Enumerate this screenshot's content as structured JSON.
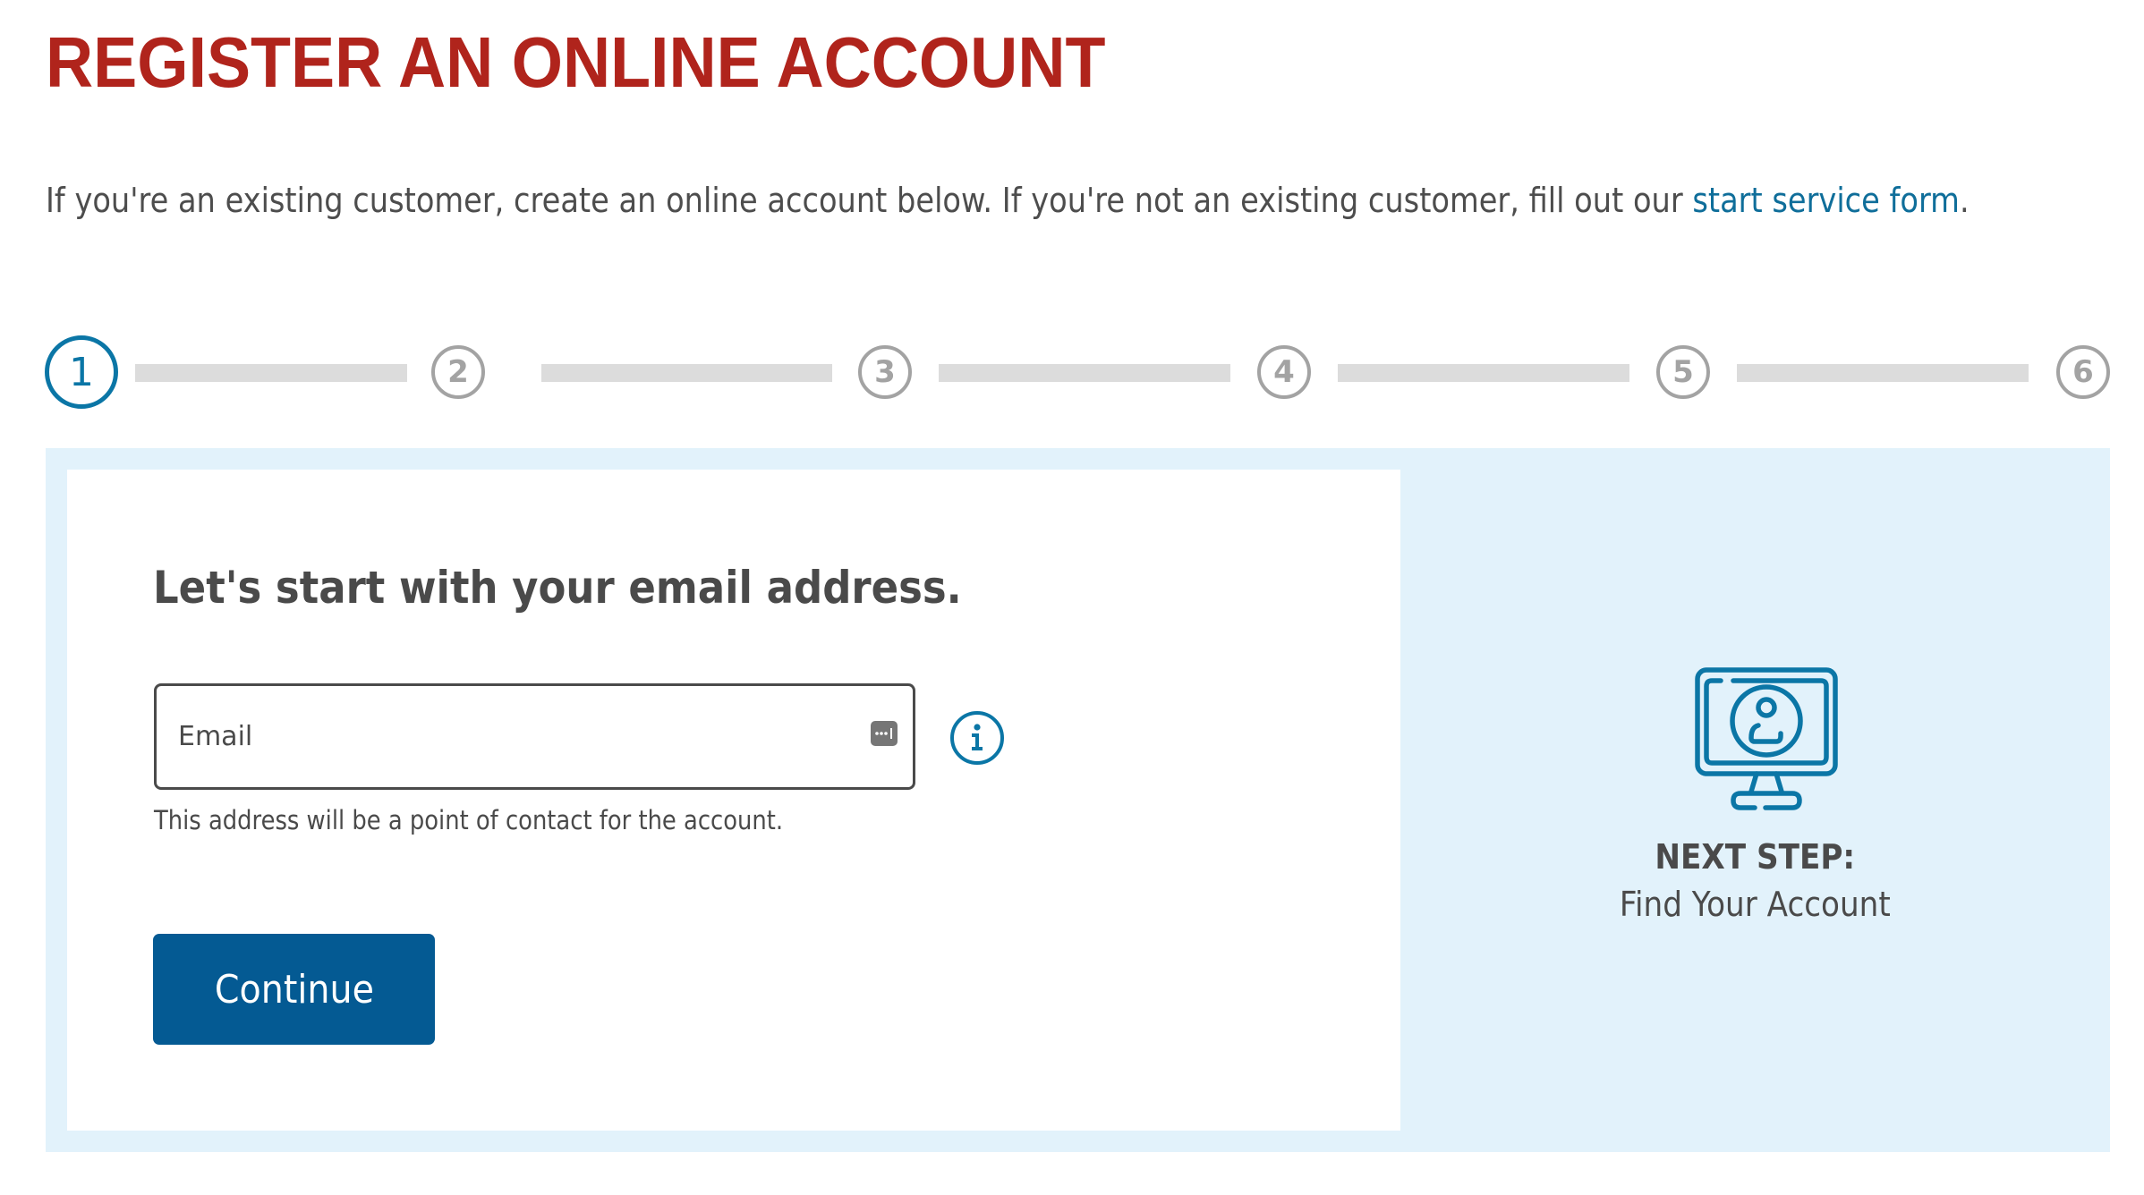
{
  "page": {
    "title": "REGISTER AN ONLINE ACCOUNT",
    "intro_text": "If you're an existing customer, create an online account below. If you're not an existing customer, fill out our ",
    "intro_link": "start service form",
    "intro_suffix": "."
  },
  "stepper": {
    "current_step": 1,
    "total_steps": 6,
    "steps": [
      {
        "label": "1",
        "state": "active"
      },
      {
        "label": "2",
        "state": "inactive"
      },
      {
        "label": "3",
        "state": "inactive"
      },
      {
        "label": "4",
        "state": "inactive"
      },
      {
        "label": "5",
        "state": "inactive"
      },
      {
        "label": "6",
        "state": "inactive"
      }
    ]
  },
  "form": {
    "heading": "Let's start with your email address.",
    "email_placeholder": "Email",
    "email_value": "",
    "helper_text": "This address will be a point of contact for the account.",
    "info_icon": "info-icon",
    "password_manager_icon": "password-manager-icon",
    "continue_label": "Continue"
  },
  "next_step": {
    "icon": "monitor-user-icon",
    "label": "NEXT STEP:",
    "value": "Find Your Account"
  },
  "colors": {
    "title": "#b0241c",
    "link": "#0f6e9a",
    "accent": "#0b76a6",
    "button": "#045a93",
    "panel_bg": "#e2f2fb",
    "inactive_step": "#a3a3a3",
    "step_bar": "#dcdcdc"
  }
}
